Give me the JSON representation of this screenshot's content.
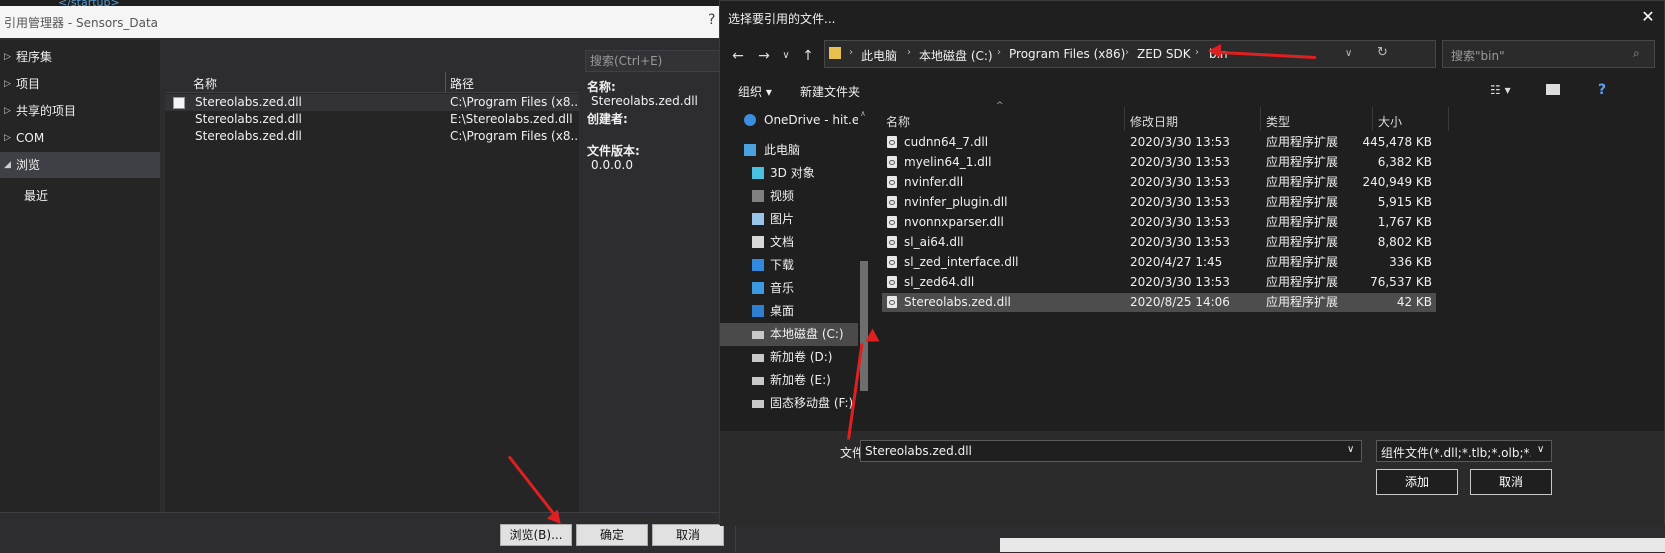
{
  "editor": {
    "snippet": "</startup>"
  },
  "ref_manager": {
    "title": "引用管理器 - Sensors_Data",
    "help": "?",
    "nav": [
      {
        "label": "程序集",
        "arrow": "▷"
      },
      {
        "label": "项目",
        "arrow": "▷"
      },
      {
        "label": "共享的项目",
        "arrow": "▷"
      },
      {
        "label": "COM",
        "arrow": "▷"
      },
      {
        "label": "浏览",
        "arrow": "◢"
      },
      {
        "label": "最近",
        "arrow": ""
      }
    ],
    "columns": {
      "name": "名称",
      "path": "路径"
    },
    "rows": [
      {
        "name": "Stereolabs.zed.dll",
        "path": "C:\\Program Files (x8..."
      },
      {
        "name": "Stereolabs.zed.dll",
        "path": "E:\\Stereolabs.zed.dll"
      },
      {
        "name": "Stereolabs.zed.dll",
        "path": "C:\\Program Files (x8..."
      }
    ],
    "search_placeholder": "搜索(Ctrl+E)",
    "detail": {
      "name_label": "名称:",
      "name_value": "Stereolabs.zed.dll",
      "creator_label": "创建者:",
      "version_label": "文件版本:",
      "version_value": "0.0.0.0"
    },
    "buttons": {
      "browse": "浏览(B)...",
      "ok": "确定",
      "cancel": "取消"
    }
  },
  "file_dialog": {
    "title": "选择要引用的文件...",
    "close": "✕",
    "breadcrumb": [
      "此电脑",
      "本地磁盘 (C:)",
      "Program Files (x86)",
      "ZED SDK",
      "bin"
    ],
    "search_placeholder": "搜索\"bin\"",
    "toolbar": {
      "organize": "组织 ▾",
      "new_folder": "新建文件夹"
    },
    "tree": [
      {
        "label": "OneDrive - hit.ed",
        "icon": "cloud-icon"
      },
      {
        "label": "此电脑",
        "icon": "computer-icon"
      },
      {
        "label": "3D 对象",
        "icon": "cube-icon"
      },
      {
        "label": "视频",
        "icon": "video-icon"
      },
      {
        "label": "图片",
        "icon": "picture-icon"
      },
      {
        "label": "文档",
        "icon": "document-icon"
      },
      {
        "label": "下载",
        "icon": "download-icon"
      },
      {
        "label": "音乐",
        "icon": "music-icon"
      },
      {
        "label": "桌面",
        "icon": "desktop-icon"
      },
      {
        "label": "本地磁盘 (C:)",
        "icon": "drive-icon"
      },
      {
        "label": "新加卷 (D:)",
        "icon": "drive-icon"
      },
      {
        "label": "新加卷 (E:)",
        "icon": "drive-icon"
      },
      {
        "label": "固态移动盘 (F:)",
        "icon": "drive-icon"
      }
    ],
    "columns": {
      "name": "名称",
      "date": "修改日期",
      "type": "类型",
      "size": "大小"
    },
    "files": [
      {
        "name": "cudnn64_7.dll",
        "date": "2020/3/30 13:53",
        "type": "应用程序扩展",
        "size": "445,478 KB"
      },
      {
        "name": "myelin64_1.dll",
        "date": "2020/3/30 13:53",
        "type": "应用程序扩展",
        "size": "6,382 KB"
      },
      {
        "name": "nvinfer.dll",
        "date": "2020/3/30 13:53",
        "type": "应用程序扩展",
        "size": "240,949 KB"
      },
      {
        "name": "nvinfer_plugin.dll",
        "date": "2020/3/30 13:53",
        "type": "应用程序扩展",
        "size": "5,915 KB"
      },
      {
        "name": "nvonnxparser.dll",
        "date": "2020/3/30 13:53",
        "type": "应用程序扩展",
        "size": "1,767 KB"
      },
      {
        "name": "sl_ai64.dll",
        "date": "2020/3/30 13:53",
        "type": "应用程序扩展",
        "size": "8,802 KB"
      },
      {
        "name": "sl_zed_interface.dll",
        "date": "2020/4/27 1:45",
        "type": "应用程序扩展",
        "size": "336 KB"
      },
      {
        "name": "sl_zed64.dll",
        "date": "2020/3/30 13:53",
        "type": "应用程序扩展",
        "size": "76,537 KB"
      },
      {
        "name": "Stereolabs.zed.dll",
        "date": "2020/8/25 14:06",
        "type": "应用程序扩展",
        "size": "42 KB"
      }
    ],
    "filename_label": "文件名(N):",
    "filename_value": "Stereolabs.zed.dll",
    "filetype_value": "组件文件(*.dll;*.tlb;*.olb;*.ocx;",
    "buttons": {
      "add": "添加",
      "cancel": "取消"
    }
  },
  "colors": {
    "annotation": "#e02020",
    "dialog_bg": "#1f1f1f",
    "selection": "#4d4d4d"
  }
}
